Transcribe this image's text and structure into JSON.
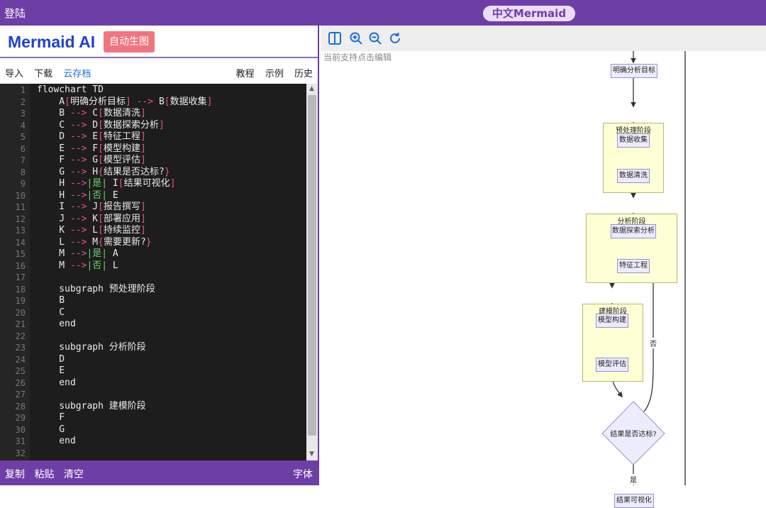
{
  "topbar": {
    "login": "登陆",
    "brand": "中文Mermaid"
  },
  "left_panel": {
    "logo": "Mermaid AI",
    "auto_button": "自动生图",
    "menu_left": [
      "导入",
      "下载",
      "云存档"
    ],
    "menu_right": [
      "教程",
      "示例",
      "历史"
    ]
  },
  "editor": {
    "line_numbers": [
      "1",
      "2",
      "3",
      "4",
      "5",
      "6",
      "7",
      "8",
      "9",
      "10",
      "11",
      "12",
      "13",
      "14",
      "15",
      "16",
      "17",
      "18",
      "19",
      "20",
      "21",
      "22",
      "23",
      "24",
      "25",
      "26",
      "27",
      "28",
      "29",
      "30",
      "31",
      "32"
    ],
    "lines": [
      "flowchart TD",
      "    A[明确分析目标] --> B[数据收集]",
      "    B --> C[数据清洗]",
      "    C --> D[数据探索分析]",
      "    D --> E[特征工程]",
      "    E --> F[模型构建]",
      "    F --> G[模型评估]",
      "    G --> H{结果是否达标?}",
      "    H -->|是| I[结果可视化]",
      "    H -->|否| E",
      "    I --> J[报告撰写]",
      "    J --> K[部署应用]",
      "    K --> L[持续监控]",
      "    L --> M{需要更新?}",
      "    M -->|是| A",
      "    M -->|否| L",
      "",
      "    subgraph 预处理阶段",
      "    B",
      "    C",
      "    end",
      "",
      "    subgraph 分析阶段",
      "    D",
      "    E",
      "    end",
      "",
      "    subgraph 建模阶段",
      "    F",
      "    G",
      "    end",
      ""
    ]
  },
  "bottombar": {
    "left": [
      "复制",
      "粘贴",
      "清空"
    ],
    "right": "字体"
  },
  "right_panel": {
    "hint": "当前支持点击编辑",
    "tools": [
      "layout-icon",
      "zoom-in-icon",
      "zoom-out-icon",
      "refresh-icon"
    ],
    "diagram": {
      "nodes": {
        "A": "明确分析目标",
        "B": "数据收集",
        "C": "数据清洗",
        "D": "数据探索分析",
        "E": "特征工程",
        "F": "模型构建",
        "G": "模型评估",
        "H": "结果是否达标?",
        "I": "结果可视化"
      },
      "subgraphs": {
        "pre": "预处理阶段",
        "analysis": "分析阶段",
        "model": "建模阶段"
      },
      "edge_labels": {
        "yes": "是",
        "no": "否"
      }
    }
  },
  "colors": {
    "accent": "#6d3fa6",
    "logo": "#1e43c9",
    "button": "#f07582",
    "node_fill": "#ececfd",
    "subgraph_fill": "#ffffd6"
  }
}
